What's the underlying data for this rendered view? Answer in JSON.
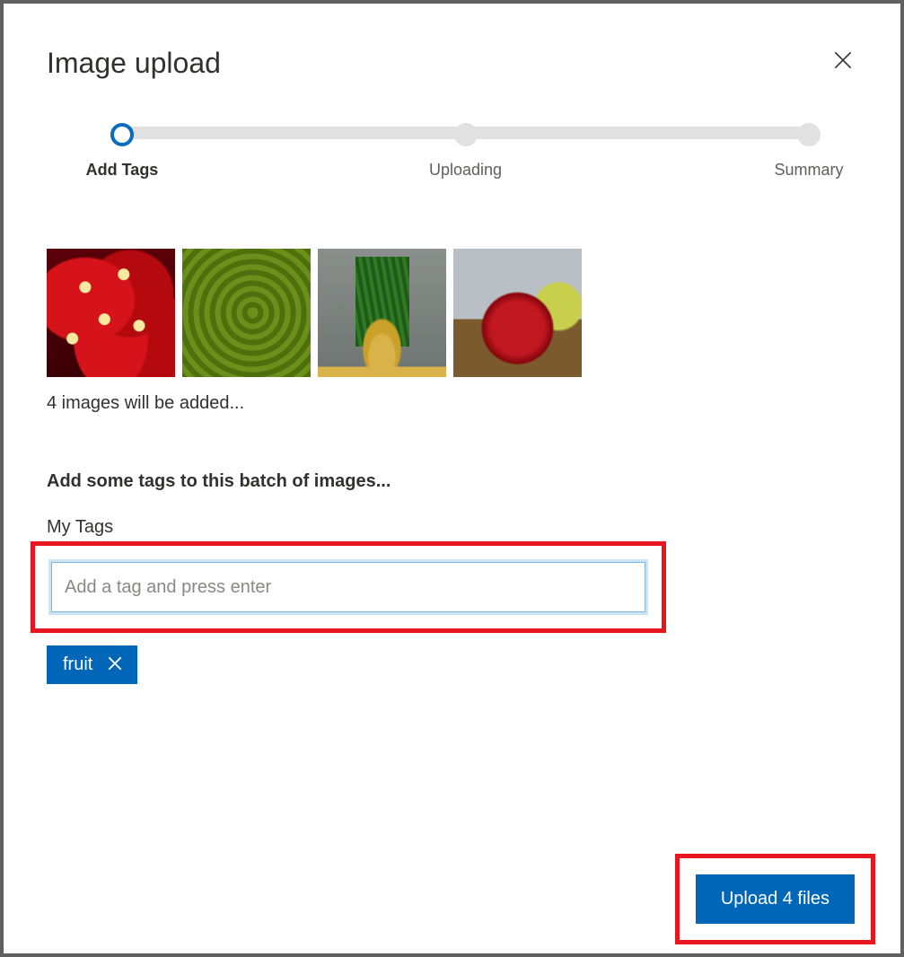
{
  "modal": {
    "title": "Image upload"
  },
  "stepper": {
    "steps": [
      {
        "label": "Add Tags"
      },
      {
        "label": "Uploading"
      },
      {
        "label": "Summary"
      }
    ]
  },
  "thumbnails": {
    "count": 4,
    "status_text": "4 images will be added..."
  },
  "tags_section": {
    "heading": "Add some tags to this batch of images...",
    "label": "My Tags",
    "input_placeholder": "Add a tag and press enter",
    "input_value": "",
    "chips": [
      {
        "label": "fruit"
      }
    ]
  },
  "actions": {
    "upload_label": "Upload 4 files"
  }
}
